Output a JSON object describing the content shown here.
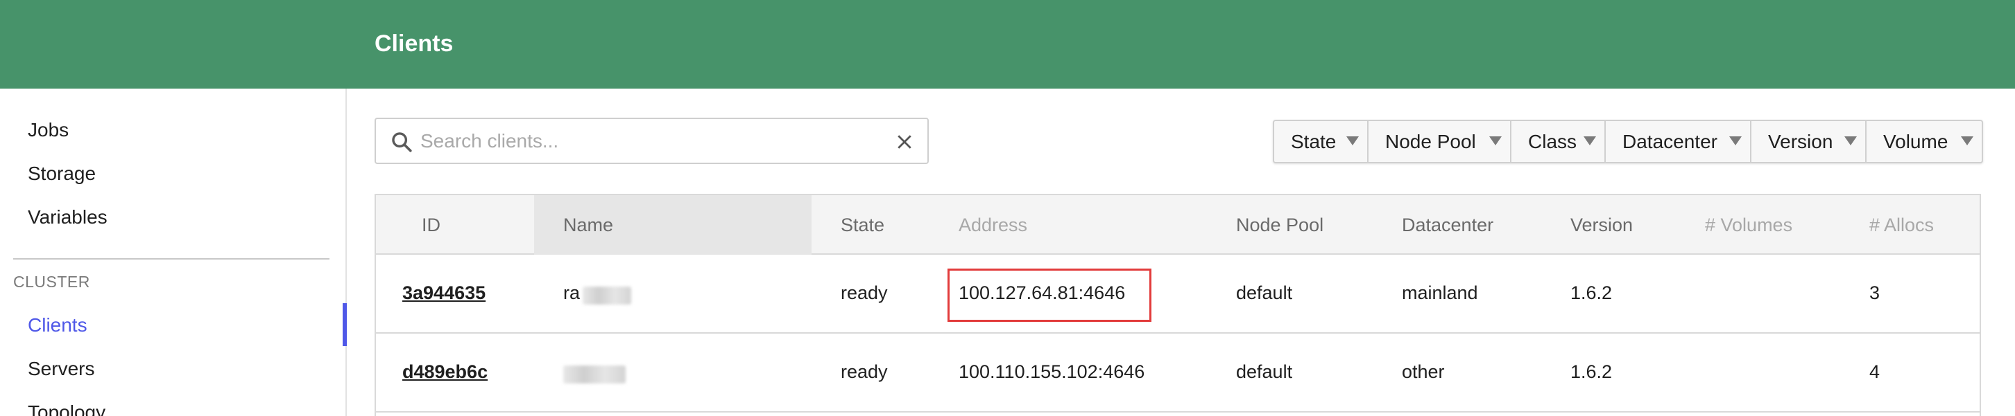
{
  "header": {
    "title": "Clients"
  },
  "sidebar": {
    "items": [
      {
        "label": "Jobs"
      },
      {
        "label": "Storage"
      },
      {
        "label": "Variables"
      }
    ],
    "section_label": "CLUSTER",
    "cluster_items": [
      {
        "label": "Clients",
        "active": true
      },
      {
        "label": "Servers"
      },
      {
        "label": "Topology"
      }
    ]
  },
  "search": {
    "placeholder": "Search clients...",
    "value": ""
  },
  "filters": [
    {
      "label": "State"
    },
    {
      "label": "Node Pool"
    },
    {
      "label": "Class"
    },
    {
      "label": "Datacenter"
    },
    {
      "label": "Version"
    },
    {
      "label": "Volume"
    }
  ],
  "table": {
    "columns": [
      "ID",
      "Name",
      "State",
      "Address",
      "Node Pool",
      "Datacenter",
      "Version",
      "# Volumes",
      "# Allocs"
    ],
    "rows": [
      {
        "id": "3a944635",
        "name_prefix": "ra",
        "state": "ready",
        "address": "100.127.64.81:4646",
        "node_pool": "default",
        "datacenter": "mainland",
        "version": "1.6.2",
        "volumes": "",
        "allocs": "3"
      },
      {
        "id": "d489eb6c",
        "name_prefix": "",
        "state": "ready",
        "address": "100.110.155.102:4646",
        "node_pool": "default",
        "datacenter": "other",
        "version": "1.6.2",
        "volumes": "",
        "allocs": "4"
      }
    ]
  },
  "colors": {
    "header_bg": "#47936a",
    "accent": "#4f58e8",
    "highlight": "#e23b3b"
  }
}
